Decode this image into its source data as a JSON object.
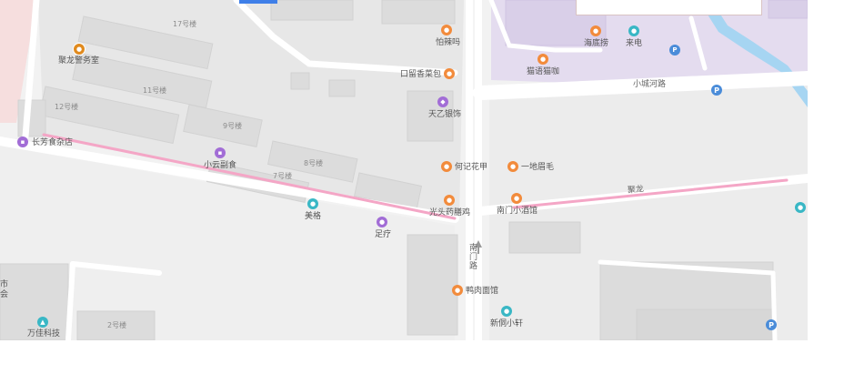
{
  "map": {
    "buildings": {
      "b17": "17号楼",
      "b11": "11号楼",
      "b12": "12号楼",
      "b9": "9号楼",
      "b8": "8号楼",
      "b7": "7号楼",
      "b2": "2号楼"
    },
    "roads": {
      "xiaochenghe": "小城河路",
      "nanmen": "南门路",
      "julong": "聚龙"
    },
    "pois": {
      "julong_police": "聚龙警务室",
      "changfang": "长芳食杂店",
      "xiaoyun": "小云副食",
      "meige": "美格",
      "zuliao": "足疗",
      "wanjia": "万佳科技",
      "shi_hui": "市\n会",
      "palami": "怕辣吗",
      "kouliuxiang": "口留香菜包",
      "tianyi": "天乙银饰",
      "heji": "何记花甲",
      "yidi": "一地眉毛",
      "guangtou": "光头药膳鸡",
      "nanmen_bar": "南门小酒馆",
      "yarou": "鸭肉面馆",
      "xinyi": "新侗小轩",
      "haidilao": "海底捞",
      "laidian": "来电",
      "maoyu": "猫语猫咖"
    },
    "icons": {
      "parking": "P"
    },
    "colors": {
      "background": "#f2f2f2",
      "block": "#e6e6e6",
      "road": "#ffffff",
      "commercial": "#e4dcef",
      "water": "#a6d5f2",
      "route": "#f4a6c6",
      "poi_orange": "#f28b3c",
      "poi_purple": "#a26dd6",
      "poi_teal": "#39b7c5",
      "parking": "#4a8cd9"
    }
  }
}
